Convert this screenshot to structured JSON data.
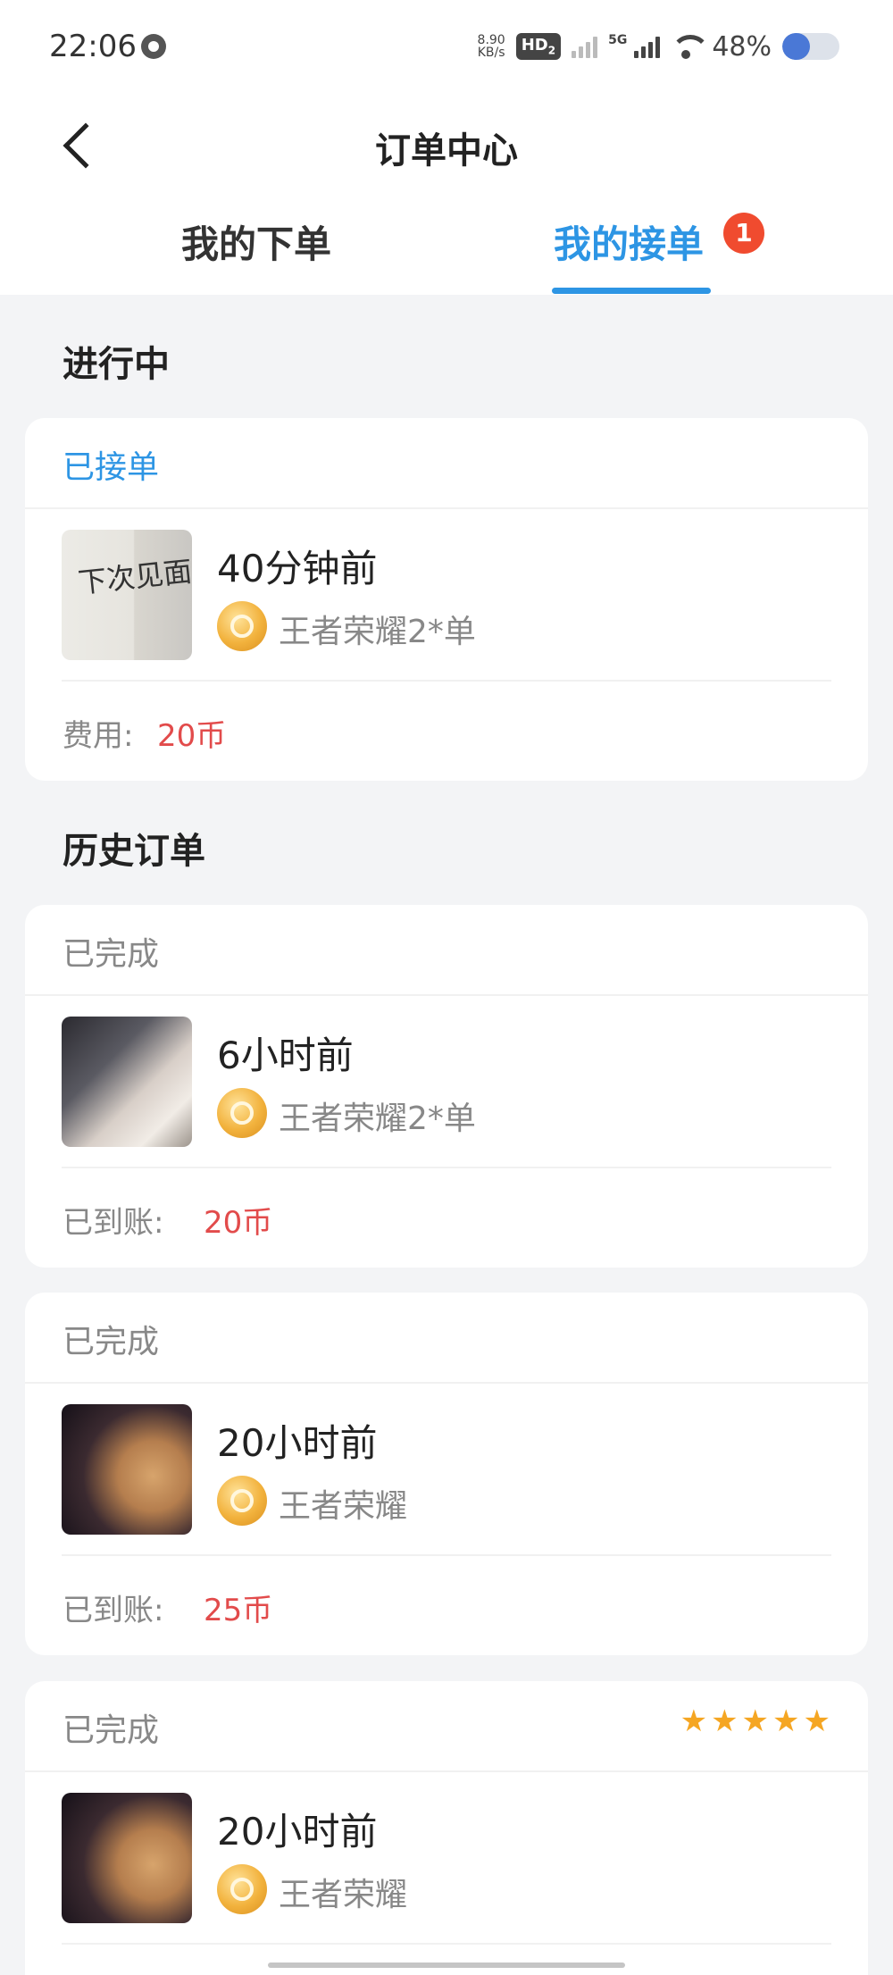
{
  "status_bar": {
    "time": "22:06",
    "net_speed_value": "8.90",
    "net_speed_unit": "KB/s",
    "hd_label": "HD",
    "hd_sub": "2",
    "network_label": "5G",
    "battery_percent": "48%",
    "battery_level": 0.48
  },
  "navbar": {
    "title": "订单中心",
    "back_icon": "chevron-left-icon"
  },
  "tabs": [
    {
      "label": "我的下单",
      "active": false
    },
    {
      "label": "我的接单",
      "active": true,
      "badge": "1"
    }
  ],
  "sections": {
    "in_progress_title": "进行中",
    "history_title": "历史订单"
  },
  "orders": [
    {
      "status": "已接单",
      "time": "40分钟前",
      "game": "王者荣耀2*单",
      "price_label": "费用:",
      "price": "20币",
      "thumb_text": "下次见面"
    },
    {
      "status": "已完成",
      "time": "6小时前",
      "game": "王者荣耀2*单",
      "price_label": "已到账:",
      "price": "20币"
    },
    {
      "status": "已完成",
      "time": "20小时前",
      "game": "王者荣耀",
      "price_label": "已到账:",
      "price": "25币"
    },
    {
      "status": "已完成",
      "time": "20小时前",
      "game": "王者荣耀",
      "rating": 5
    }
  ],
  "colors": {
    "accent": "#2d95e4",
    "price": "#e24b4b",
    "badge": "#f04b2f",
    "star": "#f5a623"
  }
}
